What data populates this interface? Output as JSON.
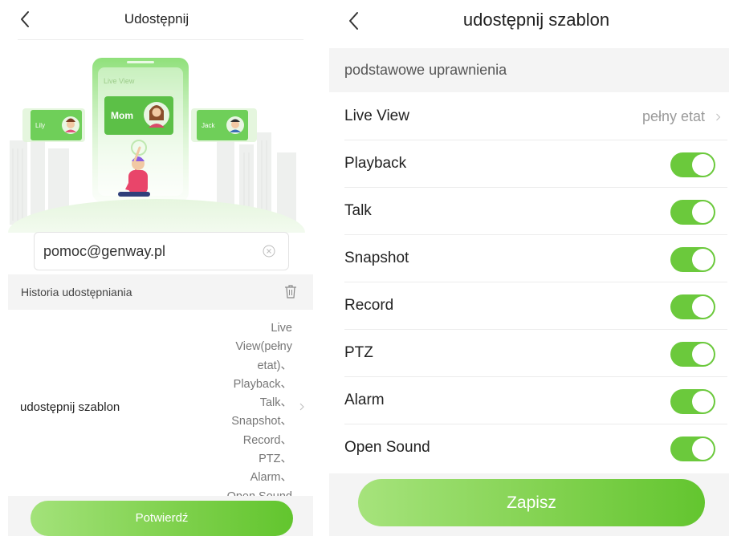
{
  "left_screen": {
    "title": "Udostępnij",
    "illustration": {
      "phone_text": "Live View",
      "card_main": "Mom",
      "card_left": "Lily",
      "card_right": "Jack"
    },
    "email": {
      "value": "pomoc@genway.pl"
    },
    "history_label": "Historia udostępniania",
    "template_row": {
      "label": "udostępnij szablon",
      "permissions_lines": [
        "Live",
        "View(pełny",
        "etat)、",
        "Playback、",
        "Talk、",
        "Snapshot、",
        "Record、",
        "PTZ、",
        "Alarm、",
        "Open Sound"
      ]
    },
    "confirm_label": "Potwierdź"
  },
  "right_screen": {
    "title": "udostępnij szablon",
    "section_label": "podstawowe uprawnienia",
    "permissions": [
      {
        "label": "Live View",
        "value": "pełny etat",
        "type": "select"
      },
      {
        "label": "Playback",
        "type": "toggle",
        "on": true
      },
      {
        "label": "Talk",
        "type": "toggle",
        "on": true
      },
      {
        "label": "Snapshot",
        "type": "toggle",
        "on": true
      },
      {
        "label": "Record",
        "type": "toggle",
        "on": true
      },
      {
        "label": "PTZ",
        "type": "toggle",
        "on": true
      },
      {
        "label": "Alarm",
        "type": "toggle",
        "on": true
      },
      {
        "label": "Open Sound",
        "type": "toggle",
        "on": true
      }
    ],
    "save_label": "Zapisz"
  },
  "colors": {
    "accent_green": "#6bc93c",
    "button_gradient_start": "#a3e27a",
    "button_gradient_end": "#62c52e",
    "section_bg": "#f4f4f4"
  },
  "icons": [
    "back-arrow-icon",
    "clear-icon",
    "trash-icon",
    "chevron-right-icon"
  ]
}
